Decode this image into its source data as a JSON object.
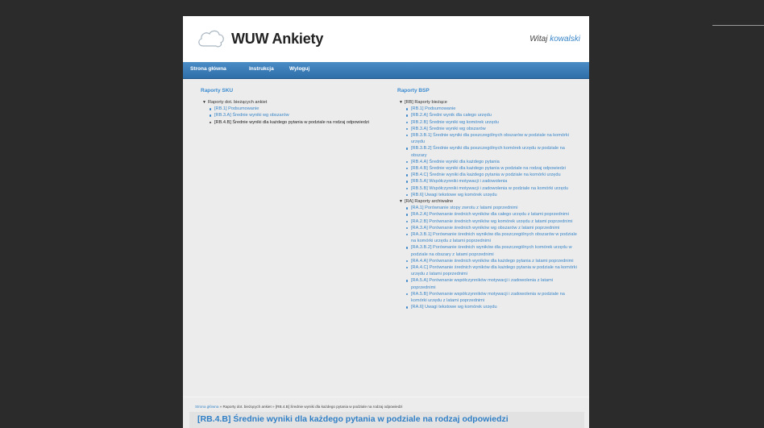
{
  "header": {
    "site_title": "WUW Ankiety",
    "welcome_prefix": "Witaj",
    "username": "kowalski"
  },
  "nav": {
    "items": [
      "Strona główna",
      "Instrukcja",
      "Wyloguj"
    ]
  },
  "sku": {
    "title": "Raporty SKU",
    "group_label": "Raporty dot. bieżących ankiet",
    "items": [
      {
        "label": "[RB.1] Podsumowanie"
      },
      {
        "label": "[RB.3.A] Średnie wyniki wg obszarów"
      },
      {
        "label": "[RB.4.B] Średnie wyniki dla każdego pytania w podziale na rodzaj odpowiedzi"
      }
    ]
  },
  "bsp": {
    "title": "Raporty BSP",
    "groups": [
      {
        "label": "[RB] Raporty bieżące",
        "items": [
          "[RB.1] Podsumowanie",
          "[RB.2.A] Średni wynik dla całego urzędu",
          "[RB.2.B] Średnie wyniki wg komórek urzędu",
          "[RB.3.A] Średnie wyniki wg obszarów",
          "[RB.3.B.1] Średnie wyniki dla poszczególnych obszarów w podziale na komórki urzędu",
          "[RB.3.B.2] Średnie wyniki dla poszczególnych komórek urzędu w podziale na obszary",
          "[RB.4.A] Średnie wyniki dla każdego pytania",
          "[RB.4.B] Średnie wyniki dla każdego pytania w podziale na rodzaj odpowiedzi",
          "[RB.4.C] Średnie wyniki dla każdego pytania w podziale na komórki urzędu",
          "[RB.5.A] Współczynniki motywacji i zadowolenia",
          "[RB.5.B] Współczynniki motywacji i zadowolenia w podziale na komórki urzędu",
          "[RB.6] Uwagi tekstowe wg komórek urzędu"
        ]
      },
      {
        "label": "[RA] Raporty archiwalne",
        "items": [
          "[RA.1] Porównanie stopy zwrotu z latami poprzednimi",
          "[RA.2.A] Porównanie średnich wyników dla całego urzędu z latami poprzednimi",
          "[RA.2.B] Porównanie średnich wyników wg komórek urzędu z latami poprzednimi",
          "[RA.3.A] Porównanie średnich wyników wg obszarów z latami poprzednimi",
          "[RA.3.B.1] Porównanie średnich wyników dla poszczególnych obszarów w podziale na komórki urzędu z latami poprzednimi",
          "[RA.3.B.2] Porównanie średnich wyników dla poszczególnych komórek urzędu w podziale na obszary z latami poprzednimi",
          "[RA.4.A] Porównanie średnich wyników dla każdego pytania z latami poprzednimi",
          "[RA.4.C] Porównanie średnich wyników dla każdego pytania w podziale na komórki urzędu z latami poprzednimi",
          "[RA.5.A] Porównanie współczynników motywacji i zadowolenia z latami poprzednimi",
          "[RA.5.B] Porównanie współczynników motywacji i zadowolenia w podziale na komórki urzędu z latami poprzednimi",
          "[RA.6] Uwagi tekstowe wg komórek urzędu"
        ]
      }
    ]
  },
  "breadcrumb": {
    "home": "Strona główna",
    "separator": "»",
    "level1": "Raporty dot. bieżących ankiet",
    "level2": "[RB.4.B] Średnie wyniki dla każdego pytania w podziale na rodzaj odpowiedzi"
  },
  "report_title": "[RB.4.B] Średnie wyniki dla każdego pytania w podziale na rodzaj odpowiedzi",
  "colors": {
    "accent": "#3a86c8",
    "navbar": "#3a7cb8",
    "background": "#2b2b2b",
    "page": "#ececec"
  }
}
